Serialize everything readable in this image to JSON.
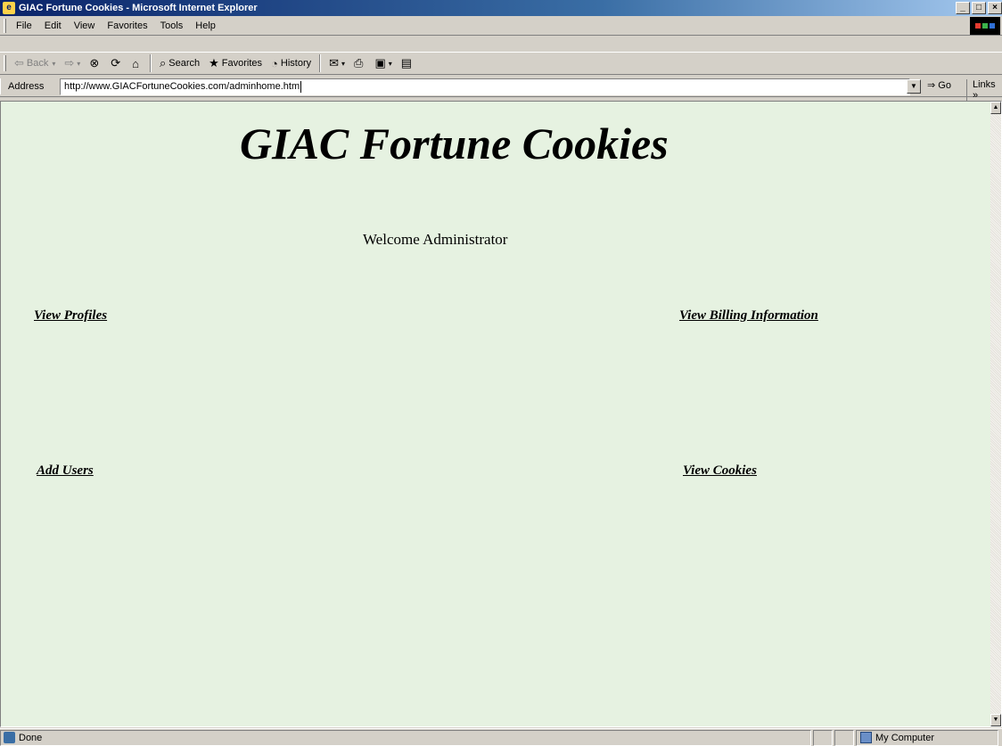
{
  "window": {
    "title": "GIAC Fortune Cookies - Microsoft Internet Explorer",
    "controls": [
      "_",
      "□",
      "×"
    ]
  },
  "menu": [
    "File",
    "Edit",
    "View",
    "Favorites",
    "Tools",
    "Help"
  ],
  "toolbar": {
    "back": "Back",
    "search": "Search",
    "favorites": "Favorites",
    "history": "History"
  },
  "address": {
    "label": "Address",
    "url": "http://www.GIACFortuneCookies.com/adminhome.htm",
    "go": "Go",
    "links": "Links"
  },
  "page": {
    "title": "GIAC Fortune Cookies",
    "welcome": "Welcome Administrator",
    "links": {
      "view_profiles": "View Profiles",
      "view_billing": "View Billing Information",
      "add_users": "Add Users",
      "view_cookies": "View Cookies"
    },
    "background": "#e6f2e1"
  },
  "status": {
    "text": "Done",
    "zone": "My Computer"
  }
}
